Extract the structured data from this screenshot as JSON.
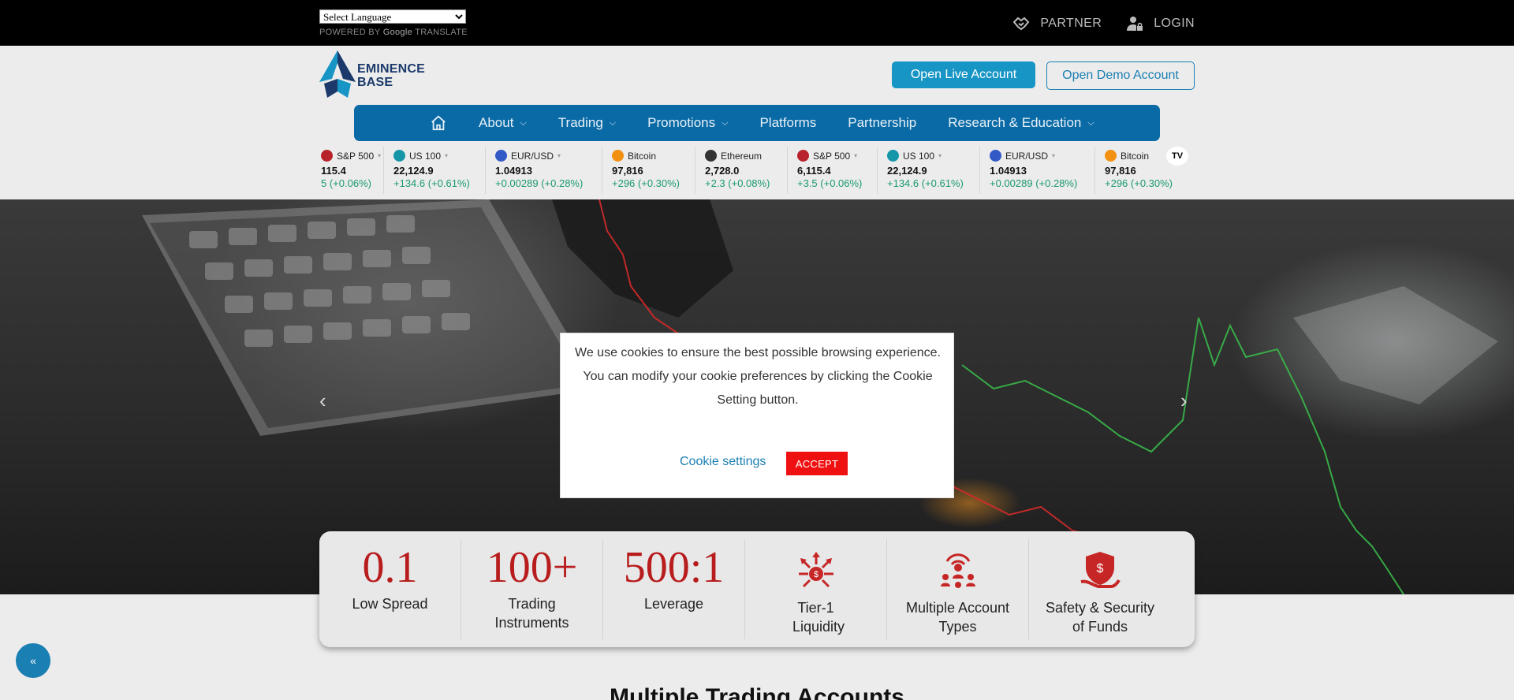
{
  "topbar": {
    "language_select": "Select Language",
    "powered_by": "POWERED BY",
    "google": "Google",
    "translate": "TRANSLATE",
    "partner": "PARTNER",
    "login": "LOGIN"
  },
  "header": {
    "logo_line1": "EMINENCE",
    "logo_line2": "BASE",
    "open_live": "Open Live Account",
    "open_demo": "Open Demo Account"
  },
  "nav": {
    "items": [
      {
        "label": "About",
        "dropdown": true
      },
      {
        "label": "Trading",
        "dropdown": true
      },
      {
        "label": "Promotions",
        "dropdown": true
      },
      {
        "label": "Platforms",
        "dropdown": false
      },
      {
        "label": "Partnership",
        "dropdown": false
      },
      {
        "label": "Research & Education",
        "dropdown": true
      }
    ]
  },
  "ticker": [
    {
      "name": "S&P 500",
      "price": "115.4",
      "change": "5 (+0.06%)",
      "color": "#b8222b"
    },
    {
      "name": "US 100",
      "price": "22,124.9",
      "change": "+134.6 (+0.61%)",
      "color": "#1595a8"
    },
    {
      "name": "EUR/USD",
      "price": "1.04913",
      "change": "+0.00289 (+0.28%)",
      "color": "#3259c6"
    },
    {
      "name": "Bitcoin",
      "price": "97,816",
      "change": "+296 (+0.30%)",
      "color": "#f29111"
    },
    {
      "name": "Ethereum",
      "price": "2,728.0",
      "change": "+2.3 (+0.08%)",
      "color": "#333333"
    },
    {
      "name": "S&P 500",
      "price": "6,115.4",
      "change": "+3.5 (+0.06%)",
      "color": "#b8222b"
    },
    {
      "name": "US 100",
      "price": "22,124.9",
      "change": "+134.6 (+0.61%)",
      "color": "#1595a8"
    },
    {
      "name": "EUR/USD",
      "price": "1.04913",
      "change": "+0.00289 (+0.28%)",
      "color": "#3259c6"
    },
    {
      "name": "Bitcoin",
      "price": "97,816",
      "change": "+296 (+0.30%)",
      "color": "#f29111"
    }
  ],
  "ticker_badges": {
    "sp": "500",
    "us": "100"
  },
  "tv_badge": "TV",
  "hero": {
    "prev": "‹",
    "next": "›"
  },
  "cookie": {
    "message": "We use cookies to ensure the best possible browsing experience. You can modify your cookie preferences by clicking the Cookie Setting button.",
    "settings": "Cookie settings",
    "accept": "ACCEPT"
  },
  "stats": [
    {
      "value": "0.1",
      "label": "Low Spread"
    },
    {
      "value": "100+",
      "label": "Trading Instruments"
    },
    {
      "value": "500:1",
      "label": "Leverage"
    },
    {
      "icon": "liquidity-icon",
      "label": "Tier-1 Liquidity"
    },
    {
      "icon": "account-types-icon",
      "label": "Multiple Account Types"
    },
    {
      "icon": "security-icon",
      "label": "Safety & Security of Funds"
    }
  ],
  "section_title": "Multiple Trading Accounts",
  "scroll_top": "«"
}
